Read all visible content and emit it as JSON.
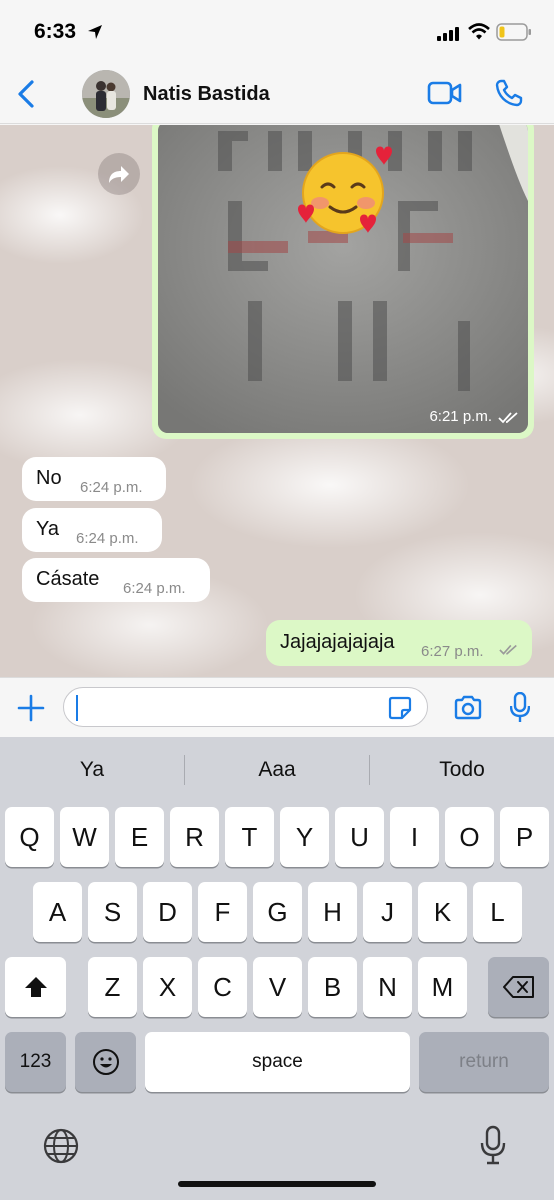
{
  "status_bar": {
    "time": "6:33"
  },
  "contact": {
    "name": "Natis Bastida"
  },
  "messages": {
    "image": {
      "time": "6:21 p.m."
    },
    "incoming": [
      {
        "text": "No",
        "time": "6:24 p.m."
      },
      {
        "text": "Ya",
        "time": "6:24 p.m."
      },
      {
        "text": "Cásate",
        "time": "6:24 p.m."
      }
    ],
    "outgoing": [
      {
        "text": "Jajajajajajaja",
        "time": "6:27 p.m."
      }
    ]
  },
  "composer": {
    "value": "",
    "placeholder": ""
  },
  "suggestions": [
    "Ya",
    "Aaa",
    "Todo"
  ],
  "keyboard": {
    "row1": [
      "Q",
      "W",
      "E",
      "R",
      "T",
      "Y",
      "U",
      "I",
      "O",
      "P"
    ],
    "row2": [
      "A",
      "S",
      "D",
      "F",
      "G",
      "H",
      "J",
      "K",
      "L"
    ],
    "row3": [
      "Z",
      "X",
      "C",
      "V",
      "B",
      "N",
      "M"
    ],
    "numbers_label": "123",
    "space_label": "space",
    "return_label": "return"
  },
  "colors": {
    "accent": "#1a7ce6",
    "outgoing_bubble": "#dcf8c6",
    "incoming_bubble": "#ffffff",
    "keyboard_bg": "#d1d3d9"
  },
  "icons": [
    "location-arrow-icon",
    "signal-icon",
    "wifi-icon",
    "battery-icon",
    "chevron-left-icon",
    "video-camera-icon",
    "phone-icon",
    "forward-icon",
    "double-check-icon",
    "plus-icon",
    "sticker-icon",
    "camera-icon",
    "microphone-icon",
    "shift-icon",
    "backspace-icon",
    "emoji-icon",
    "globe-icon"
  ]
}
